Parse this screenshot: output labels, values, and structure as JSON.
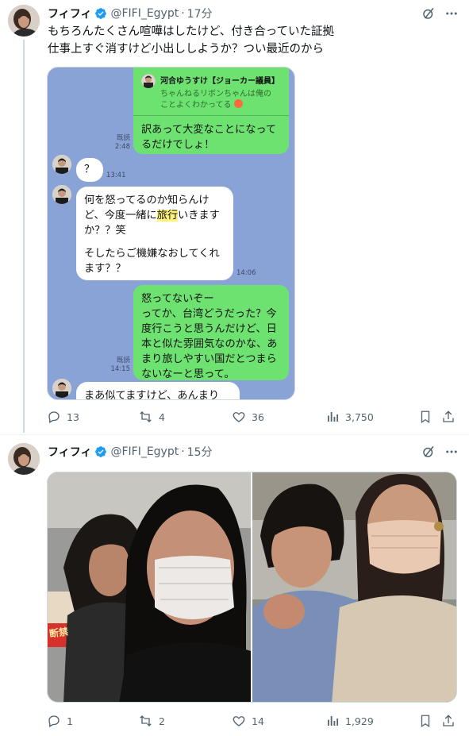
{
  "colors": {
    "link_gray": "#536471",
    "verified_blue": "#1d9bf0",
    "chat_bg": "#8aa3d7",
    "chat_green": "#6ee271",
    "highlight": "#fff27a"
  },
  "tweet1": {
    "display_name": "フィフィ",
    "handle": "@FIFI_Egypt",
    "separator": "·",
    "time": "17分",
    "text_line1": "もちろんたくさん喧嘩はしたけど、付き合っていた証拠",
    "text_line2": "仕事上すぐ消すけど小出ししようか？つい最近のから",
    "chat": {
      "reply_name": "河合ゆうすけ【ジョーカー議員】",
      "reply_text_line1": "ちゃんねるリボンちゃんは俺の",
      "reply_text_line2": "ことよくわかってる",
      "msg1_line1": "訳あって大変なことになって",
      "msg1_line2": "るだけでしょ！",
      "msg1_read": "既読",
      "msg1_time": "2:48",
      "msg2": "？",
      "msg2_time": "13:41",
      "msg3_line1": "何を怒ってるのか知らんけ",
      "msg3_line2a": "ど、今度一緒に",
      "msg3_line2b": "旅行",
      "msg3_line2c": "いきます",
      "msg3_line3": "か？？笑",
      "msg3_line4": "そしたらご機嫌なおしてくれ",
      "msg3_line5": "ます？？",
      "msg3_time": "14:06",
      "msg4_line1": "怒ってないぞー",
      "msg4_line2": "ってか、台湾どうだった？今",
      "msg4_line3": "度行こうと思うんだけど、日",
      "msg4_line4": "本と似た雰囲気なのかな、あ",
      "msg4_line5": "まり旅しやすい国だとつまら",
      "msg4_line6": "ないなーと思って。",
      "msg4_read": "既読",
      "msg4_time": "14:15",
      "msg5": "まあ似てますけど、あんまり"
    },
    "replies": "13",
    "reposts": "4",
    "likes": "36",
    "views": "3,750"
  },
  "tweet2": {
    "display_name": "フィフィ",
    "handle": "@FIFI_Egypt",
    "separator": "·",
    "time": "15分",
    "photo_sign_text": "断禁",
    "replies": "1",
    "reposts": "2",
    "likes": "14",
    "views": "1,929"
  }
}
